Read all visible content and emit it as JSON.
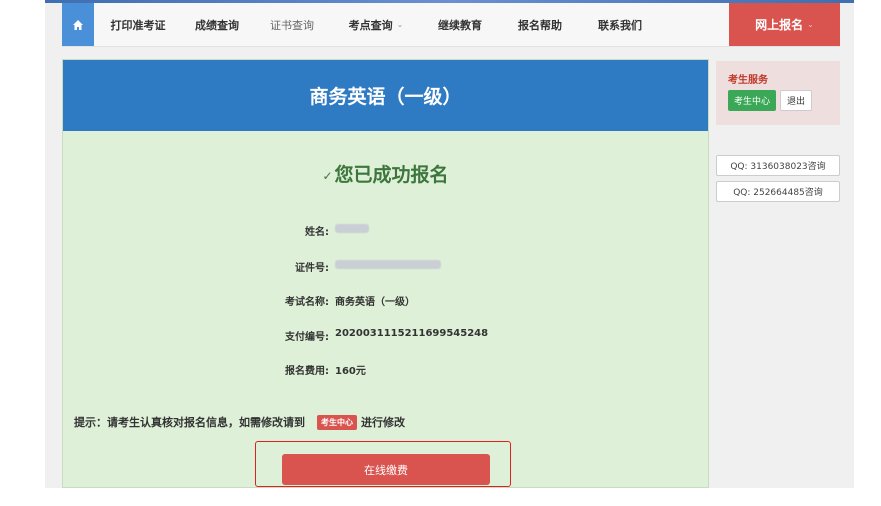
{
  "nav": {
    "home_icon": "home-icon",
    "items": [
      {
        "label": "打印准考证"
      },
      {
        "label": "成绩查询"
      },
      {
        "label": "证书查询"
      },
      {
        "label": "考点查询",
        "caret": "⌄"
      },
      {
        "label": "继续教育"
      },
      {
        "label": "报名帮助"
      },
      {
        "label": "联系我们"
      }
    ],
    "signup": {
      "label": "网上报名",
      "caret": "⌄"
    }
  },
  "panel": {
    "title": "商务英语（一级）",
    "success_check": "✓",
    "success_text": "您已成功报名",
    "fields": [
      {
        "label": "姓名:",
        "value": ""
      },
      {
        "label": "证件号:",
        "value": ""
      },
      {
        "label": "考试名称:",
        "value": "商务英语（一级）"
      },
      {
        "label": "支付编号:",
        "value": "202003111521169954524​8"
      },
      {
        "label": "报名费用:",
        "value": "160元"
      }
    ],
    "tip_prefix": "提示：请考生认真核对报名信息，如需修改请到",
    "tip_badge": "考生中心",
    "tip_suffix": "进行修改",
    "pay_button": "在线缴费"
  },
  "sidebar": {
    "service_title": "考生服务",
    "center_button": "考生中心",
    "logout_button": "退出",
    "qq": [
      "QQ: 3136038023咨询",
      "QQ: 252664485咨询"
    ]
  },
  "colors": {
    "accent_blue": "#2e7bc4",
    "success_green": "#3c763d",
    "danger_red": "#d9534f"
  }
}
